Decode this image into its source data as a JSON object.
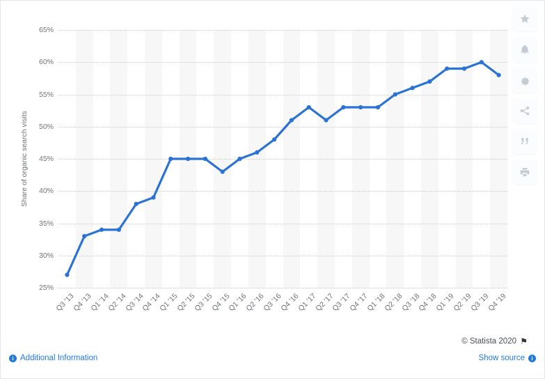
{
  "chart_data": {
    "type": "line",
    "title": "",
    "xlabel": "",
    "ylabel": "Share of organic search visits",
    "ylim": [
      25,
      65
    ],
    "ytick_labels": [
      "65%",
      "60%",
      "55%",
      "50%",
      "45%",
      "40%",
      "35%",
      "30%",
      "25%"
    ],
    "ytick_values": [
      65,
      60,
      55,
      50,
      45,
      40,
      35,
      30,
      25
    ],
    "grid": true,
    "legend": "none",
    "series_color": "#2a72d4",
    "categories": [
      "Q3 '13",
      "Q4 '13",
      "Q1 '14",
      "Q2 '14",
      "Q3 '14",
      "Q4 '14",
      "Q1 '15",
      "Q2 '15",
      "Q3 '15",
      "Q4 '15",
      "Q1 '16",
      "Q2 '16",
      "Q3 '16",
      "Q4 '16",
      "Q1 '17",
      "Q2 '17",
      "Q3 '17",
      "Q4 '17",
      "Q1 '18",
      "Q2 '18",
      "Q3 '18",
      "Q4 '18",
      "Q1 '19",
      "Q2 '19",
      "Q3 '19",
      "Q4 '19"
    ],
    "values": [
      27,
      33,
      34,
      34,
      38,
      39,
      45,
      45,
      45,
      43,
      45,
      46,
      48,
      51,
      53,
      51,
      53,
      53,
      53,
      55,
      56,
      57,
      59,
      59,
      60,
      58
    ]
  },
  "icon_rail": [
    {
      "name": "favorite-star-icon",
      "label": "star"
    },
    {
      "name": "notification-bell-icon",
      "label": "bell"
    },
    {
      "name": "settings-gear-icon",
      "label": "gear"
    },
    {
      "name": "share-icon",
      "label": "share"
    },
    {
      "name": "citation-quote-icon",
      "label": "quote"
    },
    {
      "name": "print-icon",
      "label": "print"
    }
  ],
  "footer": {
    "copyright": "© Statista 2020",
    "flag_glyph": "⚑",
    "additional_information": "Additional Information",
    "show_source": "Show source",
    "info_glyph": "i"
  }
}
